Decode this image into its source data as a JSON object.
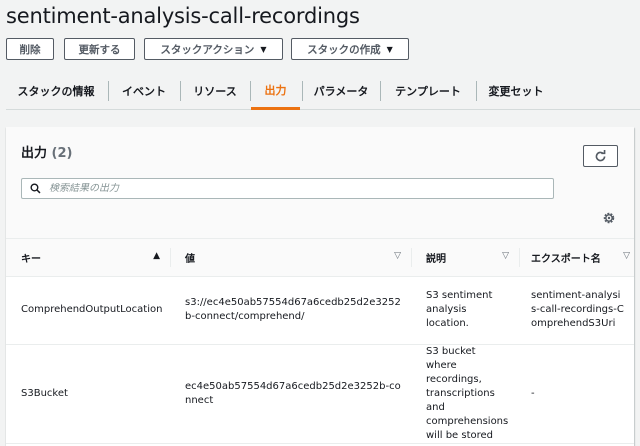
{
  "stack_name": "sentiment-analysis-call-recordings",
  "toolbar": {
    "delete_label": "削除",
    "update_label": "更新する",
    "stack_actions_label": "スタックアクション",
    "create_stack_label": "スタックの作成"
  },
  "tabs": [
    {
      "label": "スタックの情報",
      "active": false
    },
    {
      "label": "イベント",
      "active": false
    },
    {
      "label": "リソース",
      "active": false
    },
    {
      "label": "出力",
      "active": true
    },
    {
      "label": "パラメータ",
      "active": false
    },
    {
      "label": "テンプレート",
      "active": false
    },
    {
      "label": "変更セット",
      "active": false
    }
  ],
  "outputs_panel": {
    "title": "出力",
    "count": "(2)",
    "search_placeholder": "検索結果の出力",
    "columns": [
      "キー",
      "値",
      "説明",
      "エクスポート名"
    ],
    "rows": [
      {
        "key": "ComprehendOutputLocation",
        "value": "s3://ec4e50ab57554d67a6cedb25d2e3252b-connect/comprehend/",
        "description": "S3 sentiment analysis location.",
        "export_name": "sentiment-analysis-call-recordings-ComprehendS3Uri"
      },
      {
        "key": "S3Bucket",
        "value": "ec4e50ab57554d67a6cedb25d2e3252b-connect",
        "description": "S3 bucket where recordings, transcriptions and comprehensions will be stored",
        "export_name": "-"
      }
    ]
  },
  "colors": {
    "accent": "#ec7211",
    "text": "#16191f",
    "border": "#545b64"
  },
  "icons": [
    "refresh-icon",
    "search-icon",
    "gear-icon",
    "caret-down-icon",
    "sort-up-icon",
    "sort-down-icon"
  ]
}
